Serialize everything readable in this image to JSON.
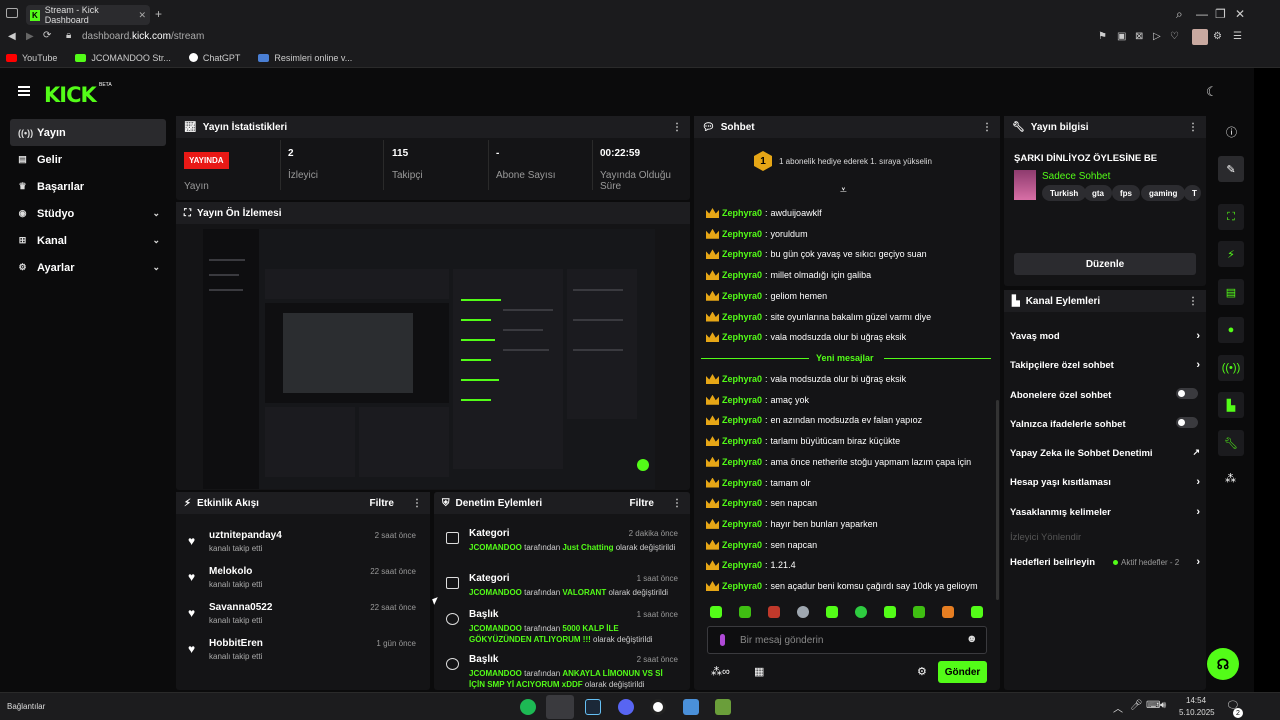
{
  "browser": {
    "tab_title": "Stream - Kick Dashboard",
    "url_prefix": "dashboard.",
    "url_host": "kick.com",
    "url_path": "/stream",
    "bookmarks": [
      "YouTube",
      "JCOMANDOO Str...",
      "ChatGPT",
      "Resimleri online v..."
    ]
  },
  "brand": {
    "logo": "KICK",
    "beta": "BETA"
  },
  "sidebar": {
    "items": [
      {
        "label": "Yayın",
        "icon": "broadcast-icon",
        "active": true
      },
      {
        "label": "Gelir",
        "icon": "revenue-icon"
      },
      {
        "label": "Başarılar",
        "icon": "trophy-icon"
      },
      {
        "label": "Stüdyo",
        "icon": "studio-icon",
        "expandable": true
      },
      {
        "label": "Kanal",
        "icon": "channel-icon",
        "expandable": true
      },
      {
        "label": "Ayarlar",
        "icon": "gear-icon",
        "expandable": true
      }
    ]
  },
  "stats": {
    "title": "Yayın İstatistikleri",
    "live_badge": "YAYINDA",
    "live_label": "Yayın",
    "viewers_value": "2",
    "viewers_label": "İzleyici",
    "followers_value": "115",
    "followers_label": "Takipçi",
    "subs_value": "-",
    "subs_label": "Abone Sayısı",
    "duration_value": "00:22:59",
    "duration_label_1": "Yayında Olduğu",
    "duration_label_2": "Süre"
  },
  "preview": {
    "title": "Yayın Ön İzlemesi"
  },
  "activity": {
    "title": "Etkinlik Akışı",
    "filter": "Filtre",
    "rows": [
      {
        "name": "uztnitepanday4",
        "sub": "kanalı takip etti",
        "time": "2 saat önce"
      },
      {
        "name": "Melokolo",
        "sub": "kanalı takip etti",
        "time": "22 saat önce"
      },
      {
        "name": "Savanna0522",
        "sub": "kanalı takip etti",
        "time": "22 saat önce"
      },
      {
        "name": "HobbitEren",
        "sub": "kanalı takip etti",
        "time": "1 gün önce"
      }
    ]
  },
  "moderation": {
    "title": "Denetim Eylemleri",
    "filter": "Filtre",
    "rows": [
      {
        "title": "Kategori",
        "time": "2 dakika önce",
        "user": "JCOMANDOO",
        "pre": " tarafından ",
        "value": "Just Chatting",
        "post": " olarak değiştirildi"
      },
      {
        "title": "Kategori",
        "time": "1 saat önce",
        "user": "JCOMANDOO",
        "pre": " tarafından ",
        "value": "VALORANT",
        "post": " olarak değiştirildi"
      },
      {
        "title": "Başlık",
        "time": "1 saat önce",
        "user": "JCOMANDOO",
        "pre": " tarafından ",
        "value": "5000 KALP İLE GÖKYÜZÜNDEN ATLIYORUM !!!",
        "post": " olarak değiştirildi"
      },
      {
        "title": "Başlık",
        "time": "2 saat önce",
        "user": "JCOMANDOO",
        "pre": " tarafından ",
        "value": "ANKAYLA LİMONUN VS Sİ İÇİN SMP Yİ ACIYORUM xDDF",
        "post": " olarak değiştirildi"
      }
    ]
  },
  "chat": {
    "title": "Sohbet",
    "pinned_count": "1",
    "pinned_text": "1 abonelik hediye ederek 1. sıraya yükselin",
    "new_messages": "Yeni mesajlar",
    "messages_before": [
      {
        "user": "Zephyra0",
        "text": "awduijoawklf"
      },
      {
        "user": "Zephyra0",
        "text": "yoruldum"
      },
      {
        "user": "Zephyra0",
        "text": "bu gün çok yavaş ve sıkıcı geçiyo suan"
      },
      {
        "user": "Zephyra0",
        "text": "millet olmadığı için galiba"
      },
      {
        "user": "Zephyra0",
        "text": "geliom hemen"
      },
      {
        "user": "Zephyra0",
        "text": "site oyunlarına bakalım güzel varmı diye"
      },
      {
        "user": "Zephyra0",
        "text": "vala modsuzda olur bi uğraş eksik"
      }
    ],
    "messages_after": [
      {
        "user": "Zephyra0",
        "text": "vala modsuzda olur bi uğraş eksik"
      },
      {
        "user": "Zephyra0",
        "text": "amaç yok"
      },
      {
        "user": "Zephyra0",
        "text": "en azından modsuzda ev falan yapıoz"
      },
      {
        "user": "Zephyra0",
        "text": "tarlamı büyütücam biraz küçükte"
      },
      {
        "user": "Zephyra0",
        "text": "ama önce netherite stoğu yapmam lazım çapa için"
      },
      {
        "user": "Zephyra0",
        "text": "tamam olr"
      },
      {
        "user": "Zephyra0",
        "text": "sen napcan"
      },
      {
        "user": "Zephyra0",
        "text": "hayır ben bunları yaparken"
      },
      {
        "user": "Zephyra0",
        "text": "sen napcan"
      },
      {
        "user": "Zephyra0",
        "text": "1.21.4"
      },
      {
        "user": "Zephyra0",
        "text": "sen açadur beni komsu çağırdı say 10dk ya gelioym"
      }
    ],
    "input_placeholder": "Bir mesaj gönderin",
    "send_label": "Gönder"
  },
  "stream_info": {
    "title": "Yayın bilgisi",
    "stream_title": "ŞARKI DİNLİYOZ ÖYLESİNE BE",
    "category": "Sadece Sohbet",
    "tags": [
      "Turkish",
      "gta",
      "fps",
      "gaming",
      "T"
    ],
    "edit_label": "Düzenle"
  },
  "channel_actions": {
    "title": "Kanal Eylemleri",
    "items": [
      {
        "label": "Yavaş mod",
        "kind": "chevron"
      },
      {
        "label": "Takipçilere özel sohbet",
        "kind": "chevron"
      },
      {
        "label": "Abonelere özel sohbet",
        "kind": "toggle"
      },
      {
        "label": "Yalnızca ifadelerle sohbet",
        "kind": "toggle"
      },
      {
        "label": "Yapay Zeka ile Sohbet Denetimi",
        "kind": "external"
      },
      {
        "label": "Hesap yaşı kısıtlaması",
        "kind": "chevron"
      },
      {
        "label": "Yasaklanmış kelimeler",
        "kind": "chevron"
      }
    ],
    "disabled_item": "İzleyici Yönlendir",
    "goals_label": "Hedefleri belirleyin",
    "goals_status": "Aktif hedefler - 2"
  },
  "taskbar": {
    "left_label": "Bağlantılar",
    "time": "14:54",
    "date": "5.10.2025",
    "notif_count": "2"
  },
  "colors": {
    "accent": "#53fc18",
    "live": "#e91916",
    "bg": "#0b0b0c",
    "panel": "#141416"
  }
}
